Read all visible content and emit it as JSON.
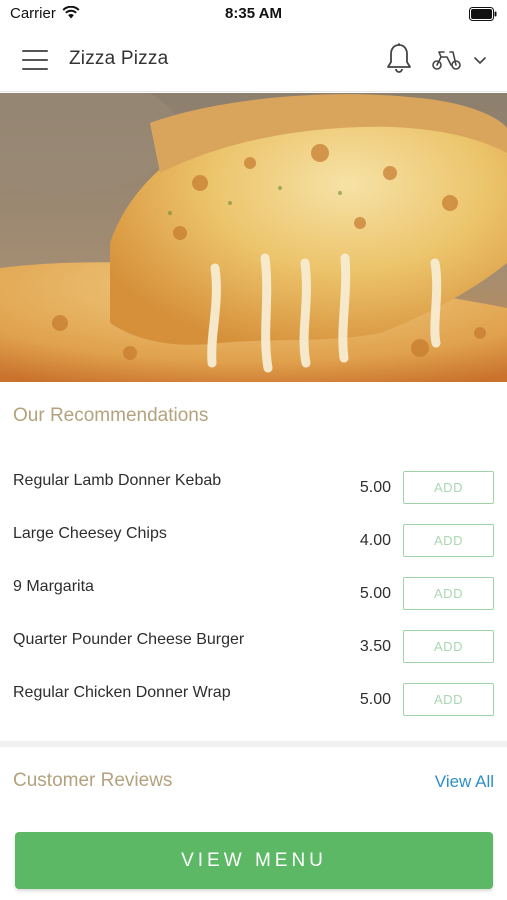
{
  "status_bar": {
    "carrier": "Carrier",
    "time": "8:35 AM"
  },
  "header": {
    "title": "Zizza Pizza",
    "icons": [
      "hamburger-menu-icon",
      "bell-icon",
      "scooter-icon",
      "chevron-down-icon"
    ]
  },
  "recommendations": {
    "title": "Our Recommendations",
    "add_label": "ADD",
    "items": [
      {
        "name": "Regular Lamb Donner Kebab",
        "price": "5.00"
      },
      {
        "name": "Large Cheesey Chips",
        "price": "4.00"
      },
      {
        "name": "9 Margarita",
        "price": "5.00"
      },
      {
        "name": "Quarter Pounder Cheese Burger",
        "price": "3.50"
      },
      {
        "name": "Regular Chicken Donner Wrap",
        "price": "5.00"
      }
    ]
  },
  "reviews": {
    "title": "Customer Reviews",
    "view_all": "View All"
  },
  "footer": {
    "view_menu": "VIEW MENU"
  },
  "colors": {
    "accent_green": "#5cb865",
    "section_title": "#b3a27d",
    "link_blue": "#2e8fc9"
  }
}
